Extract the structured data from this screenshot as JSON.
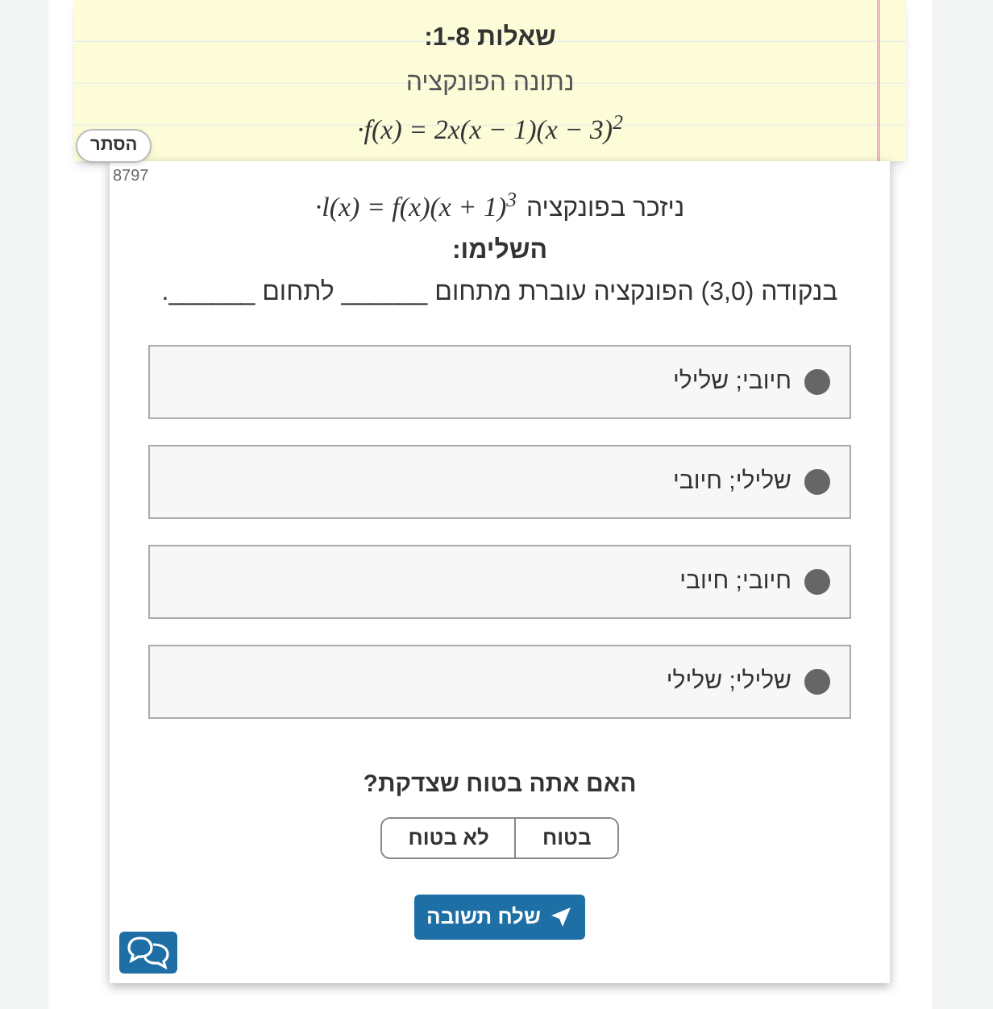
{
  "hide_button": "הסתר",
  "question_set": {
    "title": "שאלות 1-8:",
    "intro": "נתונה הפונקציה",
    "formula": "·f(x) = 2x(x − 1)(x − 3)$^{2}$"
  },
  "question_id": "8797",
  "question": {
    "lead": "ניזכר בפונקציה",
    "formula": "·l(x) = f(x)(x + 1)$^{3}$",
    "heading": "השלימו:",
    "text": "בנקודה (3,0) הפונקציה עוברת מתחום ______ לתחום ______."
  },
  "options": [
    {
      "label": "חיובי; שלילי",
      "selected": false
    },
    {
      "label": "שלילי; חיובי",
      "selected": false
    },
    {
      "label": "חיובי; חיובי",
      "selected": false
    },
    {
      "label": "שלילי; שלילי",
      "selected": false
    }
  ],
  "confidence": {
    "question": "האם אתה בטוח שצדקת?",
    "options": [
      {
        "label": "בטוח",
        "selected": false
      },
      {
        "label": "לא בטוח",
        "selected": false
      }
    ]
  },
  "submit_button": "שלח תשובה"
}
